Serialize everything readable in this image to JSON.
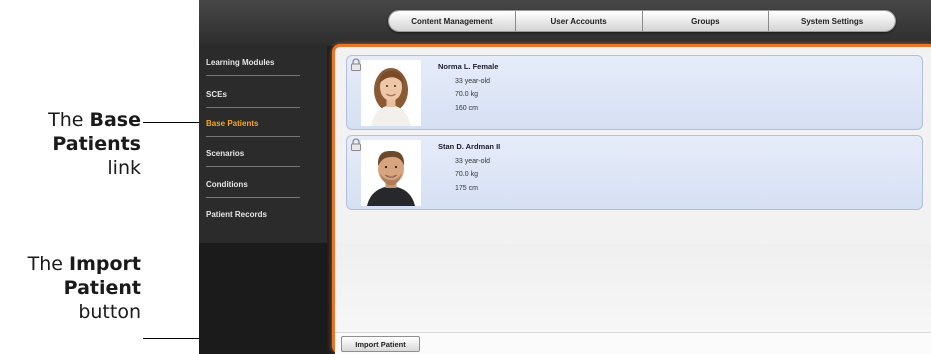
{
  "callouts": {
    "base": {
      "pre": "The ",
      "bold1": "Base",
      "bold2": "Patients",
      "post": "link"
    },
    "import": {
      "pre": "The ",
      "bold1": "Import",
      "bold2": "Patient",
      "post": "button"
    }
  },
  "top_tabs": [
    "Content Management",
    "User Accounts",
    "Groups",
    "System Settings"
  ],
  "sidebar": {
    "items": [
      {
        "label": "Learning Modules",
        "active": false
      },
      {
        "label": "SCEs",
        "active": false
      },
      {
        "label": "Base Patients",
        "active": true
      },
      {
        "label": "Scenarios",
        "active": false
      },
      {
        "label": "Conditions",
        "active": false
      },
      {
        "label": "Patient Records",
        "active": false
      }
    ]
  },
  "patients": [
    {
      "name": "Norma L. Female",
      "age": "33 year-old",
      "weight": "70.0 kg",
      "height": "160 cm",
      "icon": "lock-icon"
    },
    {
      "name": "Stan D. Ardman II",
      "age": "33 year-old",
      "weight": "70.0 kg",
      "height": "175 cm",
      "icon": "lock-icon"
    }
  ],
  "actions": {
    "import_label": "Import Patient"
  },
  "colors": {
    "accent": "#e8772c",
    "active_link": "#f7a51b",
    "card_bg": "#dfe6f6",
    "sidebar_bg": "#2b2b2b"
  }
}
